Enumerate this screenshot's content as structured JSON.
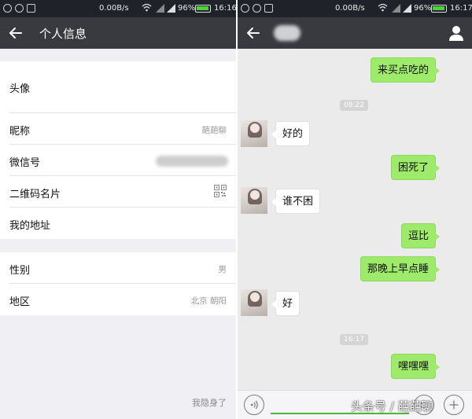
{
  "left": {
    "status": {
      "speed": "0.00B/s",
      "battery": "96%",
      "time": "16:16"
    },
    "title": "个人信息",
    "group1": [
      {
        "label": "头像"
      },
      {
        "label": "昵称",
        "value": "葩葩聊"
      },
      {
        "label": "微信号"
      },
      {
        "label": "二维码名片"
      },
      {
        "label": "我的地址"
      }
    ],
    "group2": [
      {
        "label": "性别",
        "value": "男"
      },
      {
        "label": "地区",
        "value": "北京 朝阳"
      }
    ],
    "hidden_note": "我隐身了"
  },
  "right": {
    "status": {
      "speed": "0.00B/s",
      "battery": "96%",
      "time": "16:17"
    },
    "messages": [
      {
        "from": "me",
        "text": "来买点吃的"
      },
      {
        "from": "time",
        "text": "08:22"
      },
      {
        "from": "them",
        "text": "好的"
      },
      {
        "from": "me",
        "text": "困死了"
      },
      {
        "from": "them",
        "text": "谁不困"
      },
      {
        "from": "me",
        "text": "逗比"
      },
      {
        "from": "me",
        "text": "那晚上早点睡"
      },
      {
        "from": "them",
        "text": "好"
      },
      {
        "from": "time",
        "text": "16:17"
      },
      {
        "from": "me",
        "text": "嘿嘿嘿"
      }
    ]
  },
  "watermark": "头条号 / 葩葩聊",
  "colors": {
    "title_bar": "#393a3f",
    "status_bar": "#1f2329",
    "bubble_me": "#9eea6a",
    "bubble_them": "#ffffff",
    "chat_bg": "#ebebeb",
    "battery": "#4fd23c"
  },
  "icons": [
    "back-arrow-icon",
    "profile-icon",
    "qr-code-icon",
    "voice-icon",
    "emoji-icon",
    "plus-icon",
    "wifi-icon",
    "signal-icon",
    "battery-icon"
  ]
}
